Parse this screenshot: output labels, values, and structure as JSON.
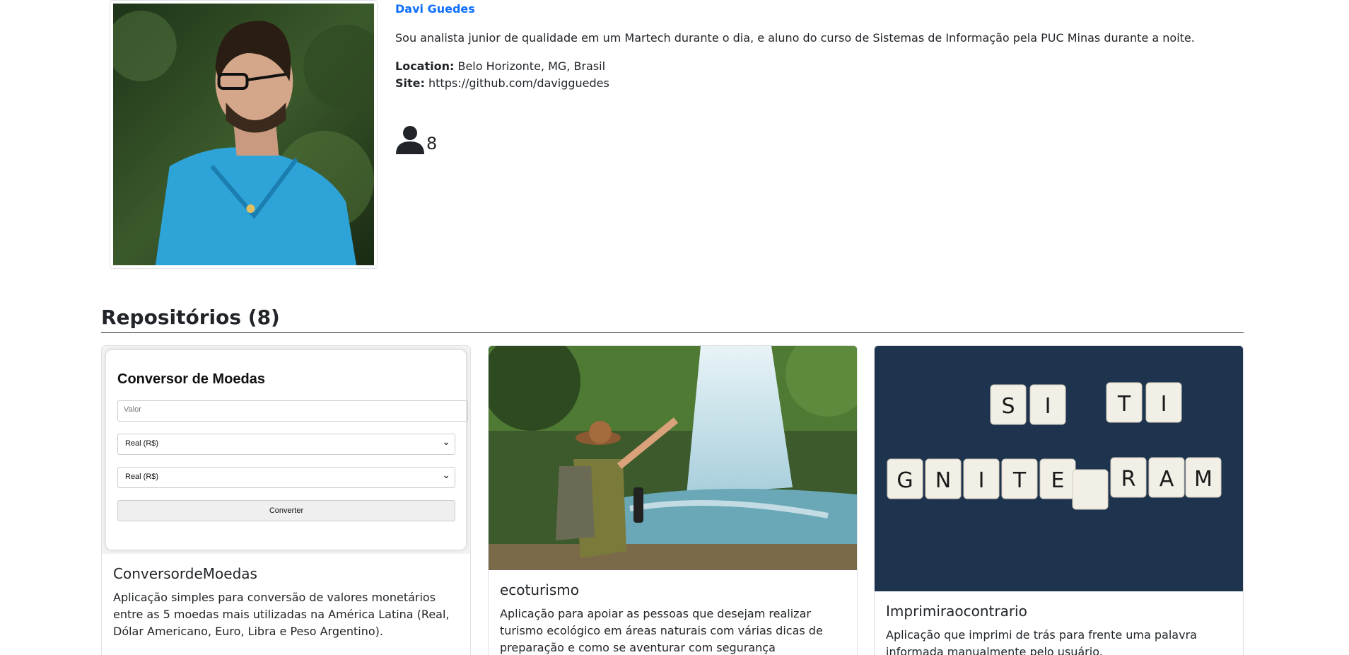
{
  "profile": {
    "name": "Davi Guedes",
    "bio": "Sou analista junior de qualidade em um Martech durante o dia, e aluno do curso de Sistemas de Informação pela PUC Minas durante a noite.",
    "location_label": "Location:",
    "location": "Belo Horizonte, MG, Brasil",
    "site_label": "Site:",
    "site": "https://github.com/davigguedes",
    "followers_icon": "person-icon",
    "followers": "8"
  },
  "repos": {
    "title": "Repositórios (8)",
    "cards": [
      {
        "title": "ConversordeMoedas",
        "description": "Aplicação simples para conversão de valores monetários entre as 5 moedas mais utilizadas na América Latina (Real, Dólar Americano, Euro, Libra e Peso Argentino).",
        "preview": {
          "heading": "Conversor de Moedas",
          "input_placeholder": "Valor",
          "select_from": "Real (R$)",
          "select_to": "Real (R$)",
          "button": "Converter"
        }
      },
      {
        "title": "ecoturismo",
        "description": "Aplicação para apoiar as pessoas que desejam realizar turismo ecológico em áreas naturais com várias dicas de preparação e como se aventurar com segurança"
      },
      {
        "title": "Imprimiraocontrario",
        "description": "Aplicação que imprimi de trás para frente uma palavra informada manualmente pelo usuário."
      }
    ]
  },
  "colors": {
    "link": "#0d6efd",
    "text": "#212529",
    "border": "#dee2e6"
  }
}
